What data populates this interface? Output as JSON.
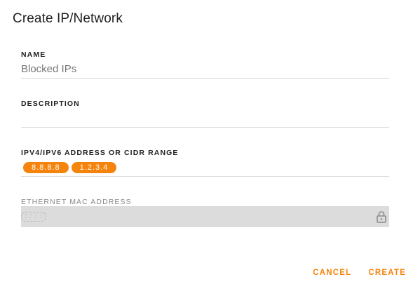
{
  "dialog": {
    "title": "Create IP/Network"
  },
  "fields": {
    "name": {
      "label": "NAME",
      "value": "Blocked IPs"
    },
    "description": {
      "label": "DESCRIPTION",
      "value": ""
    },
    "addresses": {
      "label": "IPV4/IPV6 ADDRESS OR CIDR RANGE",
      "chips": [
        "8.8.8.8",
        "1.2.3.4"
      ]
    },
    "mac": {
      "label": "ETHERNET MAC ADDRESS",
      "placeholder": ": : : :",
      "disabled": true
    }
  },
  "actions": {
    "cancel": "CANCEL",
    "create": "CREATE"
  },
  "colors": {
    "accent": "#f5840c",
    "disabled_bg": "#dcdcdc"
  },
  "icons": {
    "mac_lock": "lock-icon"
  }
}
